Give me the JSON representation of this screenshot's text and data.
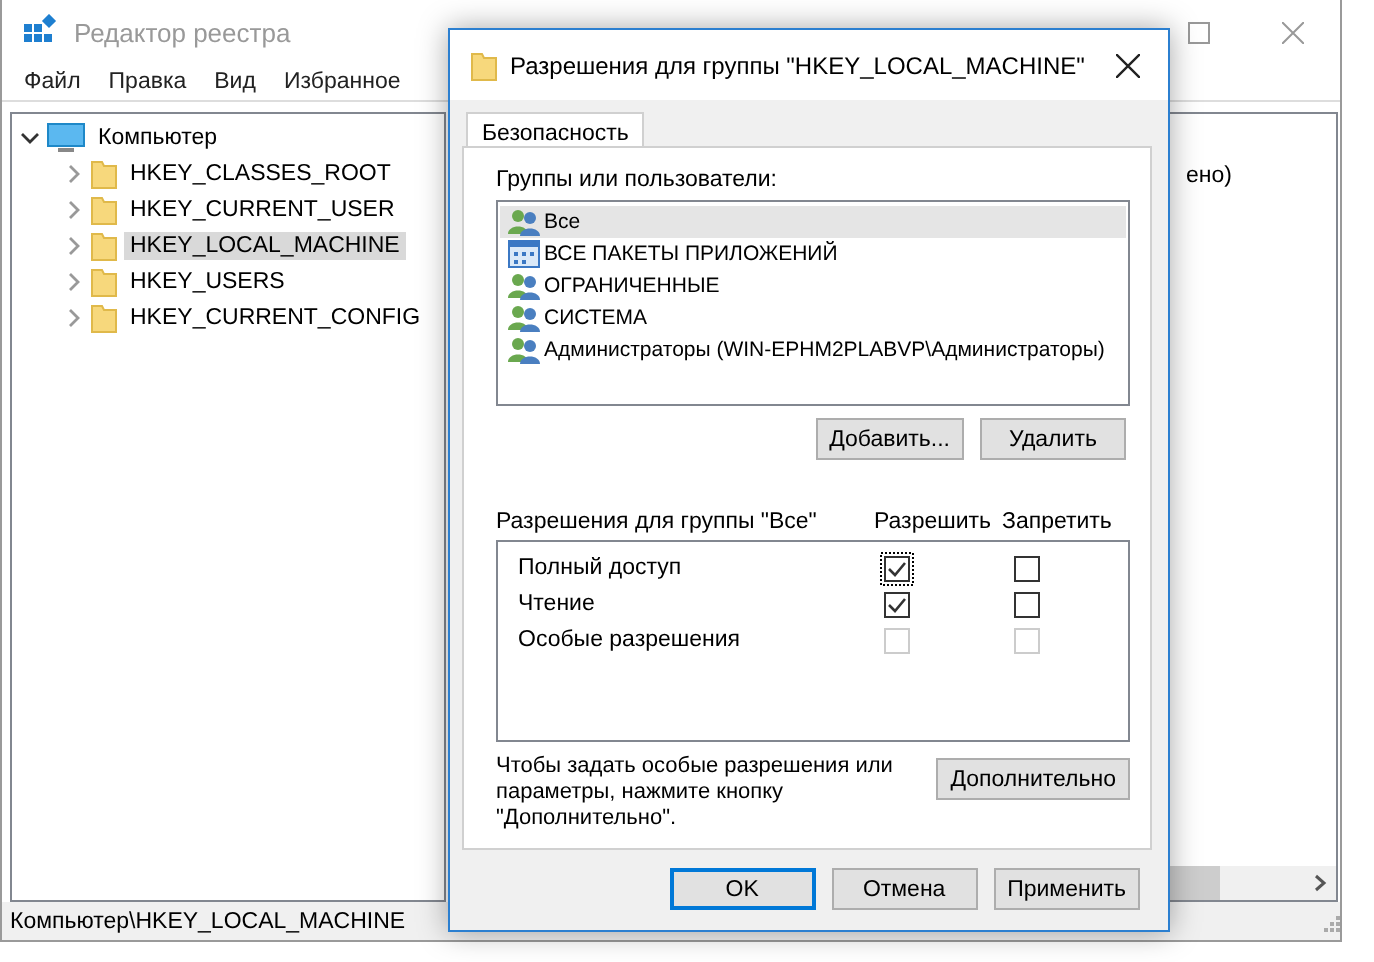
{
  "regedit": {
    "title": "Редактор реестра",
    "menu": [
      "Файл",
      "Правка",
      "Вид",
      "Избранное"
    ],
    "tree": {
      "label": "Компьютер",
      "expanded": true,
      "children": [
        {
          "label": "HKEY_CLASSES_ROOT",
          "expanded": false,
          "selected": false
        },
        {
          "label": "HKEY_CURRENT_USER",
          "expanded": false,
          "selected": false
        },
        {
          "label": "HKEY_LOCAL_MACHINE",
          "expanded": false,
          "selected": true
        },
        {
          "label": "HKEY_USERS",
          "expanded": false,
          "selected": false
        },
        {
          "label": "HKEY_CURRENT_CONFIG",
          "expanded": false,
          "selected": false
        }
      ]
    },
    "value_fragment": "ено)",
    "status_bar": "Компьютер\\HKEY_LOCAL_MACHINE"
  },
  "dialog": {
    "title": "Разрешения для группы \"HKEY_LOCAL_MACHINE\"",
    "tabs": [
      {
        "label": "Безопасность",
        "selected": true
      }
    ],
    "groups_label": "Группы или пользователи:",
    "principals": [
      {
        "name": "Все",
        "kind": "group",
        "selected": true
      },
      {
        "name": "ВСЕ ПАКЕТЫ ПРИЛОЖЕНИЙ",
        "kind": "package",
        "selected": false
      },
      {
        "name": "ОГРАНИЧЕННЫЕ",
        "kind": "group",
        "selected": false
      },
      {
        "name": "СИСТЕМА",
        "kind": "group",
        "selected": false
      },
      {
        "name": "Администраторы (WIN-EPHM2PLABVP\\Администраторы)",
        "kind": "group",
        "selected": false
      }
    ],
    "add_button": "Добавить...",
    "remove_button": "Удалить",
    "permissions_label": "Разрешения для группы \"Все\"",
    "allow_header": "Разрешить",
    "deny_header": "Запретить",
    "permissions": [
      {
        "name": "Полный доступ",
        "allow": true,
        "deny": false,
        "disabled": false,
        "focused": true
      },
      {
        "name": "Чтение",
        "allow": true,
        "deny": false,
        "disabled": false,
        "focused": false
      },
      {
        "name": "Особые разрешения",
        "allow": false,
        "deny": false,
        "disabled": true,
        "focused": false
      }
    ],
    "advanced_note": "Чтобы задать особые разрешения или параметры, нажмите кнопку \"Дополнительно\".",
    "advanced_button": "Дополнительно",
    "buttons": [
      {
        "label": "OK",
        "default": true
      },
      {
        "label": "Отмена",
        "default": false
      },
      {
        "label": "Применить",
        "default": false
      }
    ]
  }
}
